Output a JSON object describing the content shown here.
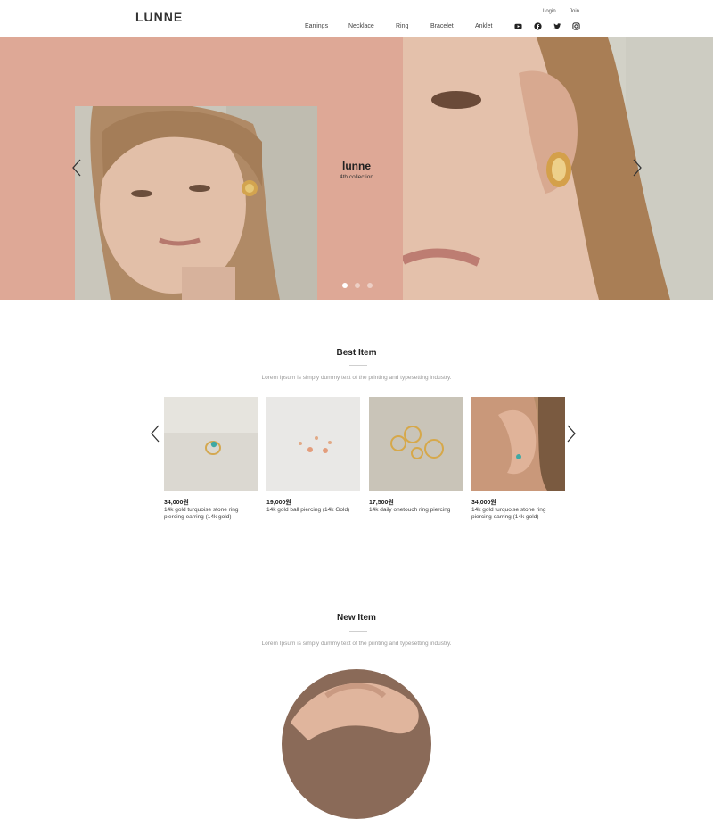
{
  "header": {
    "logo": "LUNNE",
    "login": "Login",
    "join": "Join",
    "nav": [
      "Earrings",
      "Necklace",
      "Ring",
      "Bracelet",
      "Anklet"
    ],
    "social_icons": [
      "youtube-icon",
      "facebook-icon",
      "twitter-icon",
      "instagram-icon"
    ]
  },
  "hero": {
    "title": "lunne",
    "subtitle": "4th collection",
    "background_color": "#dea896",
    "slide_count": 3,
    "active_slide": 0
  },
  "best": {
    "title": "Best Item",
    "description": "Lorem Ipsum is simply dummy text of the printing and typesetting industry.",
    "products": [
      {
        "price": "34,000원",
        "name": "14k gold turquoise stone ring piercing earring (14k gold)"
      },
      {
        "price": "19,000원",
        "name": "14k gold ball piercing (14k Gold)"
      },
      {
        "price": "17,500원",
        "name": "14k daily onetouch ring piercing"
      },
      {
        "price": "34,000원",
        "name": "14k gold turquoise stone ring piercing earring (14k gold)"
      }
    ]
  },
  "new": {
    "title": "New Item",
    "description": "Lorem Ipsum is simply dummy text of the printing and typesetting industry."
  }
}
